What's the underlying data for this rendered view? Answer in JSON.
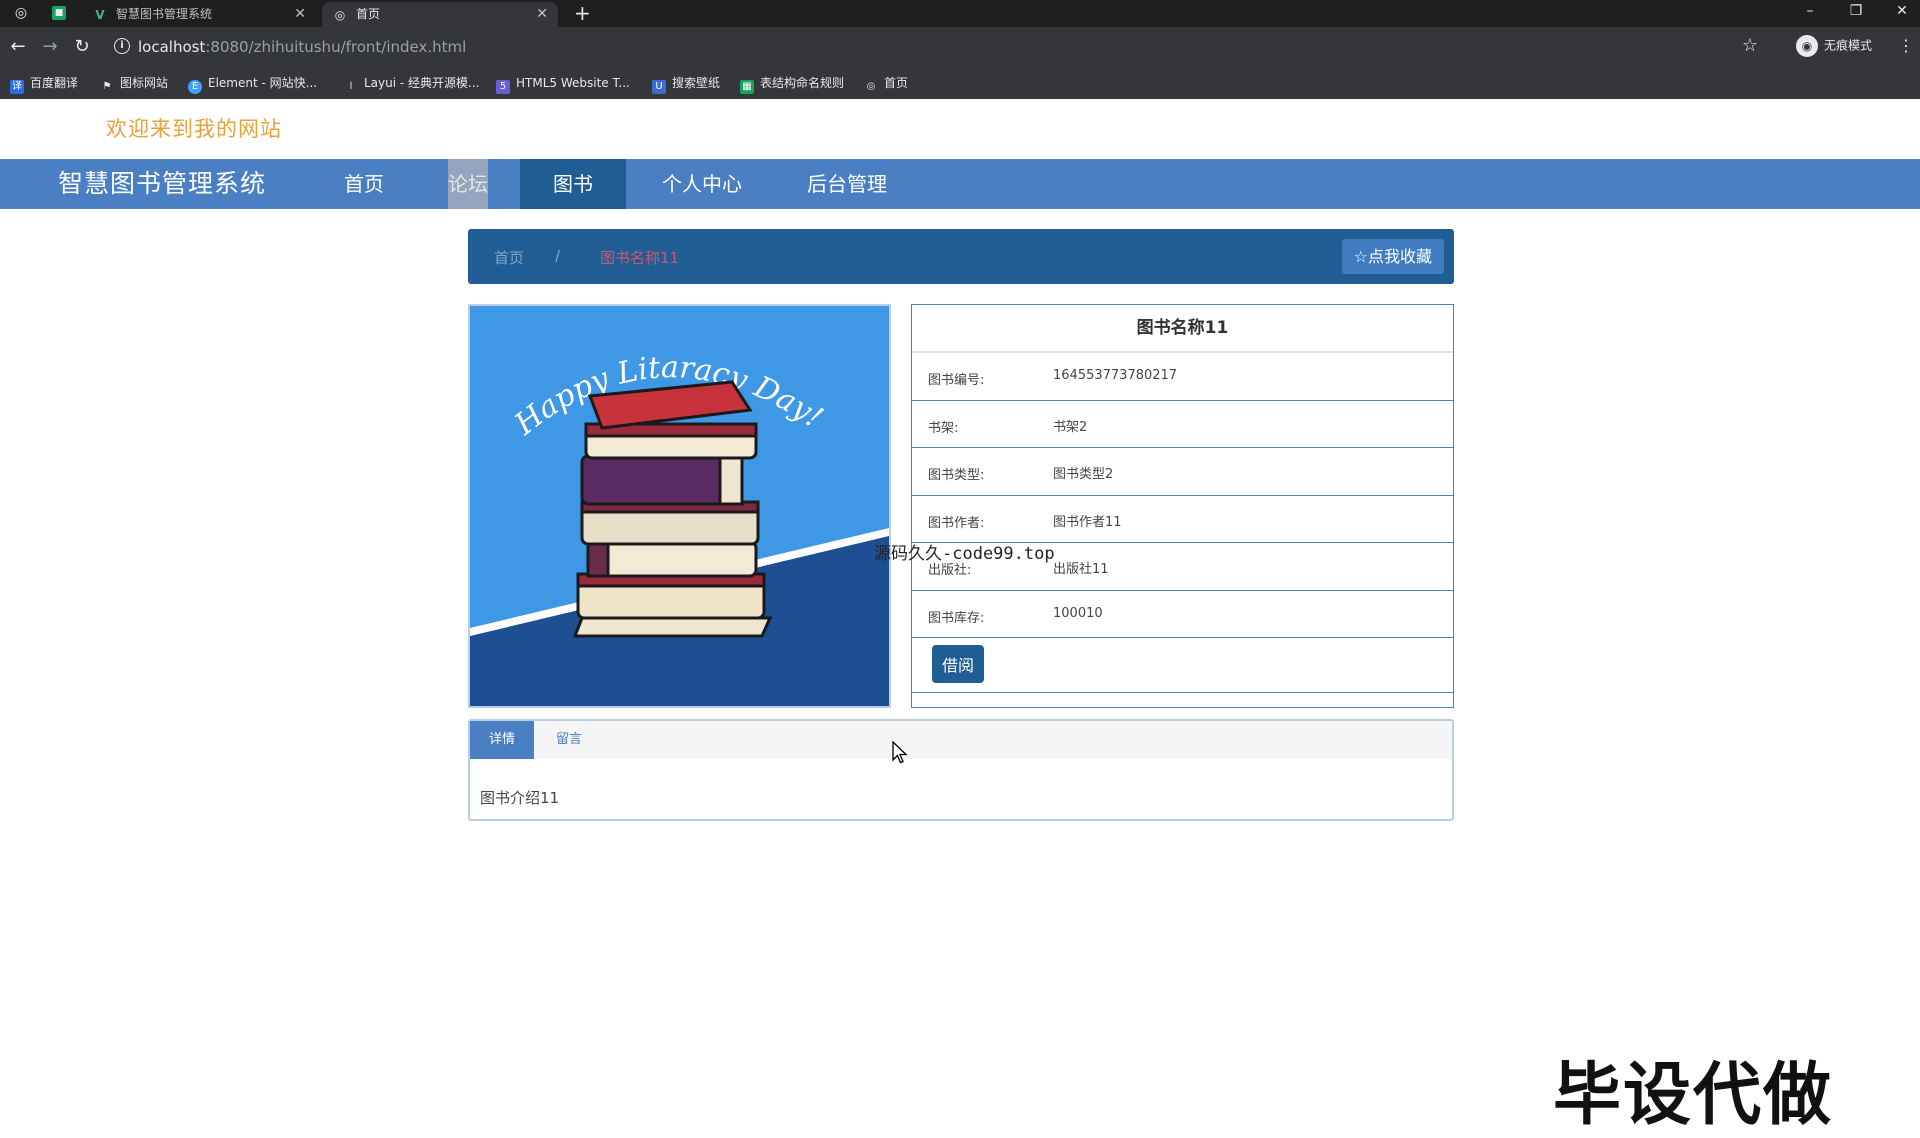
{
  "browser": {
    "tabs": [
      {
        "label": "智慧图书管理系统",
        "active": false
      },
      {
        "label": "首页",
        "active": true
      }
    ],
    "url_host": "localhost",
    "url_rest": ":8080/zhihuitushu/front/index.html",
    "incognito_label": "无痕模式",
    "bookmarks": [
      "百度翻译",
      "图标网站",
      "Element - 网站快...",
      "Layui - 经典开源模...",
      "HTML5 Website T...",
      "搜索壁纸",
      "表结构命名规则",
      "首页"
    ]
  },
  "page": {
    "welcome": "欢迎来到我的网站",
    "brand": "智慧图书管理系统",
    "nav": [
      "首页",
      "论坛",
      "图书",
      "个人中心",
      "后台管理"
    ],
    "breadcrumb": {
      "home": "首页",
      "separator": "/",
      "current": "图书名称11"
    },
    "favorite_button": "☆点我收藏",
    "cover": {
      "banner_text": "Happy Litaracy Day!"
    },
    "book": {
      "title": "图书名称11",
      "fields": [
        {
          "label": "图书编号:",
          "value": "164553773780217"
        },
        {
          "label": "书架:",
          "value": "书架2"
        },
        {
          "label": "图书类型:",
          "value": "图书类型2"
        },
        {
          "label": "图书作者:",
          "value": "图书作者11"
        },
        {
          "label": "出版社:",
          "value": "出版社11"
        },
        {
          "label": "图书库存:",
          "value": "100010"
        }
      ],
      "borrow_button": "借阅"
    },
    "tabs": [
      "详情",
      "留言"
    ],
    "intro": "图书介绍11"
  },
  "overlay": {
    "watermark": "源码久久-code99.top",
    "corner_text": "毕设代做"
  },
  "colors": {
    "navbar": "#4a7fc4",
    "nav_active": "#1f5d94",
    "welcome": "#e6a23c",
    "breadcrumb_current": "#c85a72"
  }
}
